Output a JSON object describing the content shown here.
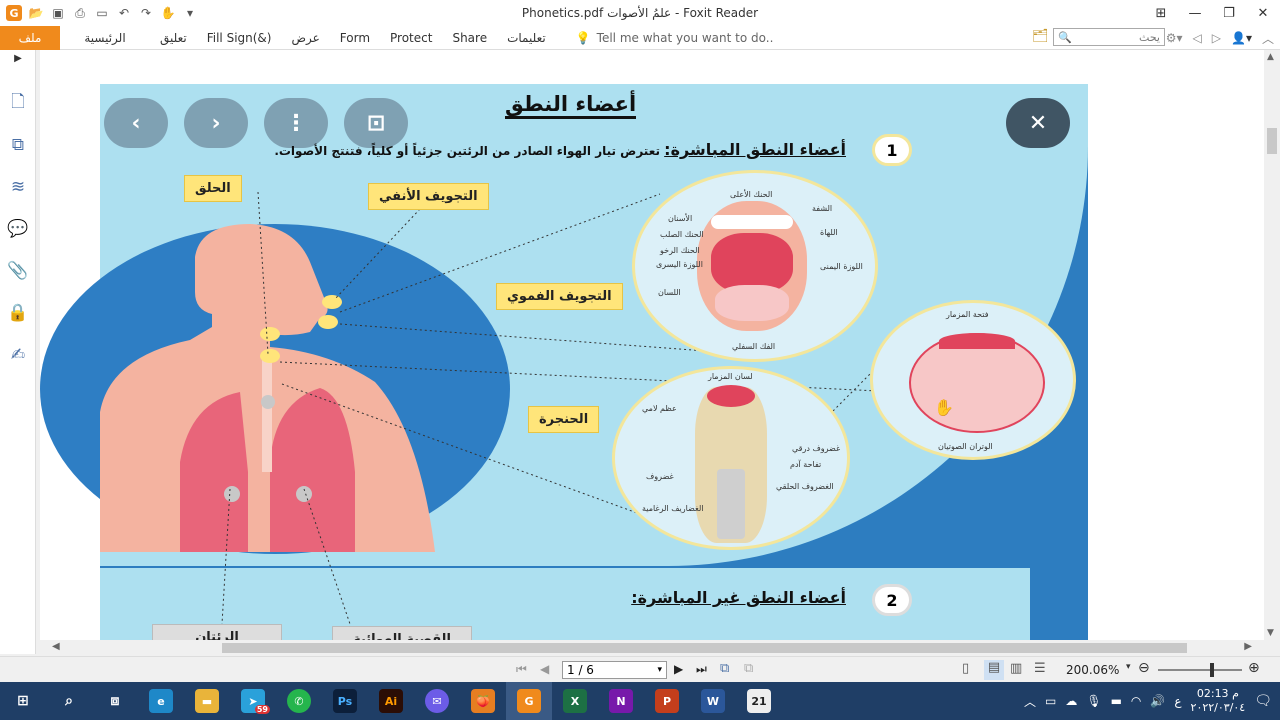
{
  "window": {
    "title": "Phonetics.pdf علمُ الأصوات - Foxit Reader"
  },
  "ribbon": {
    "file_tab": "ملف",
    "tabs": [
      "الرئيسية",
      "تعليق",
      "Fill  Sign(&)",
      "عرض",
      "Form",
      "Protect",
      "Share",
      "تعليمات"
    ],
    "tell_me": "Tell me what you want to do..",
    "search_placeholder": "يحث"
  },
  "document": {
    "main_title": "أعضاء النطق",
    "section1": {
      "number": "1",
      "heading": "أعضاء النطق المباشرة:",
      "text": "تعترض تيار الهواء الصادر من الرئتين جزئياً أو كلياً، فتنتج الأصوات."
    },
    "labels": {
      "throat": "الحلق",
      "nasal": "التجويف الأنفي",
      "oral": "التجويف الفموي",
      "larynx": "الحنجرة",
      "lungs": "الرئتان",
      "trachea": "القصبة الهوائية"
    },
    "mouth_parts": [
      "الحنك الأعلى",
      "الشفة",
      "الأسنان",
      "اللهاة",
      "الحنك الصلب",
      "الحنك الرخو",
      "اللوزة اليمنى",
      "اللوزة اليسرى",
      "اللسان",
      "الفك السفلي"
    ],
    "larynx_parts": [
      "لسان المزمار",
      "عظم لامي",
      "غضروف درقي",
      "تفاحة آدم",
      "غضروف",
      "الغضروف الحلقي",
      "الغضاريف الرغامية"
    ],
    "glottis_parts": [
      "فتحة المزمار",
      "الوتران الصوتيان"
    ],
    "section2": {
      "number": "2",
      "heading": "أعضاء النطق غير المباشرة:"
    }
  },
  "status": {
    "page_display": "1 / 6",
    "zoom": "200.06%"
  },
  "taskbar": {
    "time": "02:13 م",
    "date": "٢٠٢٢/٠٣/٠٤",
    "lang": "ع",
    "telegram_badge": "59",
    "calendar_day": "21"
  }
}
